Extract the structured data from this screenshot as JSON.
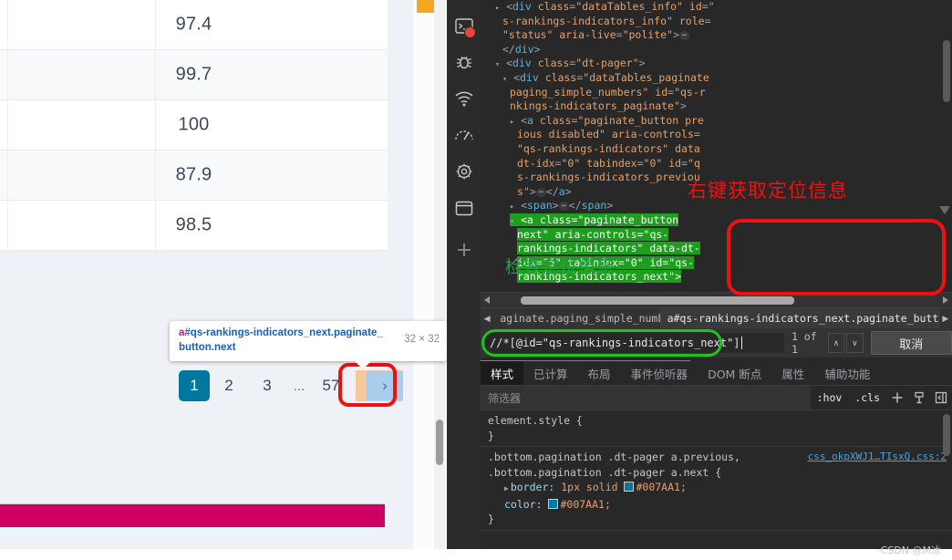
{
  "page": {
    "table": {
      "rows": [
        {
          "value": "97.4"
        },
        {
          "value": "99.7"
        },
        {
          "value": "100"
        },
        {
          "value": "87.9"
        },
        {
          "value": "98.5"
        }
      ]
    },
    "pagination": {
      "pages": [
        "1",
        "2",
        "3",
        "...",
        "57"
      ],
      "active": "1",
      "next_label": "›",
      "next_title": "next"
    },
    "tooltip": {
      "tag": "a",
      "selector": "#qs-rankings-indicators_next.paginate_button.next",
      "size": "32 × 32"
    }
  },
  "devtools": {
    "sidebar_icons": [
      {
        "name": "console-icon",
        "badge": "error"
      },
      {
        "name": "bug-icon"
      },
      {
        "name": "network-icon"
      },
      {
        "name": "performance-icon"
      },
      {
        "name": "memory-chip-icon"
      },
      {
        "name": "application-icon"
      },
      {
        "name": "add-icon"
      }
    ],
    "dom_lines": [
      {
        "indent": 2,
        "segs": [
          {
            "t": "tri",
            "v": "▸"
          },
          {
            "t": "punct",
            "v": "<"
          },
          {
            "t": "tag",
            "v": "div"
          },
          {
            "t": "sp",
            "v": " "
          },
          {
            "t": "attr",
            "v": "class"
          },
          {
            "t": "punct",
            "v": "="
          },
          {
            "t": "str",
            "v": "\"dataTables_info\""
          },
          {
            "t": "sp",
            "v": " "
          },
          {
            "t": "attr",
            "v": "id"
          },
          {
            "t": "punct",
            "v": "=\""
          }
        ]
      },
      {
        "indent": 3,
        "segs": [
          {
            "t": "str",
            "v": "s-rankings-indicators_info\""
          },
          {
            "t": "sp",
            "v": " "
          },
          {
            "t": "attr",
            "v": "role"
          },
          {
            "t": "punct",
            "v": "="
          }
        ]
      },
      {
        "indent": 3,
        "segs": [
          {
            "t": "str",
            "v": "\"status\""
          },
          {
            "t": "sp",
            "v": " "
          },
          {
            "t": "attr",
            "v": "aria-live"
          },
          {
            "t": "punct",
            "v": "="
          },
          {
            "t": "str",
            "v": "\"polite\""
          },
          {
            "t": "punct",
            "v": ">"
          },
          {
            "t": "ellip",
            "v": "⋯"
          }
        ]
      },
      {
        "indent": 3,
        "segs": [
          {
            "t": "punct",
            "v": "</"
          },
          {
            "t": "tag",
            "v": "div"
          },
          {
            "t": "punct",
            "v": ">"
          }
        ]
      },
      {
        "indent": 2,
        "segs": [
          {
            "t": "tri",
            "v": "▾"
          },
          {
            "t": "punct",
            "v": "<"
          },
          {
            "t": "tag",
            "v": "div"
          },
          {
            "t": "sp",
            "v": " "
          },
          {
            "t": "attr",
            "v": "class"
          },
          {
            "t": "punct",
            "v": "="
          },
          {
            "t": "str",
            "v": "\"dt-pager\""
          },
          {
            "t": "punct",
            "v": ">"
          }
        ]
      },
      {
        "indent": 3,
        "segs": [
          {
            "t": "tri",
            "v": "▾"
          },
          {
            "t": "punct",
            "v": "<"
          },
          {
            "t": "tag",
            "v": "div"
          },
          {
            "t": "sp",
            "v": " "
          },
          {
            "t": "attr",
            "v": "class"
          },
          {
            "t": "punct",
            "v": "="
          },
          {
            "t": "str",
            "v": "\"dataTables_paginate"
          }
        ]
      },
      {
        "indent": 4,
        "segs": [
          {
            "t": "str",
            "v": "paging_simple_numbers\""
          },
          {
            "t": "sp",
            "v": " "
          },
          {
            "t": "attr",
            "v": "id"
          },
          {
            "t": "punct",
            "v": "="
          },
          {
            "t": "str",
            "v": "\"qs-r"
          }
        ]
      },
      {
        "indent": 4,
        "segs": [
          {
            "t": "str",
            "v": "nkings-indicators_paginate\""
          },
          {
            "t": "punct",
            "v": ">"
          }
        ]
      },
      {
        "indent": 4,
        "segs": [
          {
            "t": "tri",
            "v": "▸"
          },
          {
            "t": "punct",
            "v": "<"
          },
          {
            "t": "tag",
            "v": "a"
          },
          {
            "t": "sp",
            "v": " "
          },
          {
            "t": "attr",
            "v": "class"
          },
          {
            "t": "punct",
            "v": "="
          },
          {
            "t": "str",
            "v": "\"paginate_button pre"
          }
        ]
      },
      {
        "indent": 5,
        "segs": [
          {
            "t": "str",
            "v": "ious disabled\""
          },
          {
            "t": "sp",
            "v": " "
          },
          {
            "t": "attr",
            "v": "aria-controls"
          },
          {
            "t": "punct",
            "v": "="
          }
        ]
      },
      {
        "indent": 5,
        "segs": [
          {
            "t": "str",
            "v": "\"qs-rankings-indicators\""
          },
          {
            "t": "sp",
            "v": " "
          },
          {
            "t": "attr",
            "v": "data"
          }
        ]
      },
      {
        "indent": 5,
        "segs": [
          {
            "t": "attr",
            "v": "dt-idx"
          },
          {
            "t": "punct",
            "v": "="
          },
          {
            "t": "str",
            "v": "\"0\""
          },
          {
            "t": "sp",
            "v": " "
          },
          {
            "t": "attr",
            "v": "tabindex"
          },
          {
            "t": "punct",
            "v": "="
          },
          {
            "t": "str",
            "v": "\"0\""
          },
          {
            "t": "sp",
            "v": " "
          },
          {
            "t": "attr",
            "v": "id"
          },
          {
            "t": "punct",
            "v": "="
          },
          {
            "t": "str",
            "v": "\"q"
          }
        ]
      },
      {
        "indent": 5,
        "segs": [
          {
            "t": "str",
            "v": "s-rankings-indicators_previou"
          }
        ]
      },
      {
        "indent": 5,
        "segs": [
          {
            "t": "str",
            "v": "s"
          },
          {
            "t": "punct",
            "v": "\">"
          },
          {
            "t": "ellip",
            "v": "⋯"
          },
          {
            "t": "punct",
            "v": "</"
          },
          {
            "t": "tag",
            "v": "a"
          },
          {
            "t": "punct",
            "v": ">"
          }
        ]
      },
      {
        "indent": 4,
        "segs": [
          {
            "t": "tri",
            "v": "▸"
          },
          {
            "t": "punct",
            "v": "<"
          },
          {
            "t": "tag",
            "v": "span"
          },
          {
            "t": "punct",
            "v": ">"
          },
          {
            "t": "ellip",
            "v": "⋯"
          },
          {
            "t": "punct",
            "v": "</"
          },
          {
            "t": "tag",
            "v": "span"
          },
          {
            "t": "punct",
            "v": ">"
          }
        ]
      },
      {
        "indent": 4,
        "hl": true,
        "segs": [
          {
            "t": "tri",
            "v": "▾"
          },
          {
            "t": "punct",
            "v": "<"
          },
          {
            "t": "tag",
            "v": "a"
          },
          {
            "t": "sp",
            "v": " "
          },
          {
            "t": "attr",
            "v": "class"
          },
          {
            "t": "punct",
            "v": "="
          },
          {
            "t": "str",
            "v": "\"paginate_button"
          }
        ]
      },
      {
        "indent": 5,
        "hl": true,
        "segs": [
          {
            "t": "str",
            "v": "next\""
          },
          {
            "t": "sp",
            "v": " "
          },
          {
            "t": "attr",
            "v": "aria-controls"
          },
          {
            "t": "punct",
            "v": "="
          },
          {
            "t": "str",
            "v": "\"qs-"
          }
        ]
      },
      {
        "indent": 5,
        "hl": true,
        "segs": [
          {
            "t": "str",
            "v": "rankings-indicators\""
          },
          {
            "t": "sp",
            "v": " "
          },
          {
            "t": "attr",
            "v": "data-dt-"
          }
        ]
      },
      {
        "indent": 5,
        "hl": true,
        "segs": [
          {
            "t": "attr",
            "v": "idx"
          },
          {
            "t": "punct",
            "v": "="
          },
          {
            "t": "str",
            "v": "\"5\""
          },
          {
            "t": "sp",
            "v": " "
          },
          {
            "t": "attr",
            "v": "tabindex"
          },
          {
            "t": "punct",
            "v": "="
          },
          {
            "t": "str",
            "v": "\"0\""
          },
          {
            "t": "sp",
            "v": " "
          },
          {
            "t": "attr",
            "v": "id"
          },
          {
            "t": "punct",
            "v": "="
          },
          {
            "t": "str",
            "v": "\"qs-"
          }
        ]
      },
      {
        "indent": 5,
        "hl": true,
        "segs": [
          {
            "t": "str",
            "v": "rankings-indicators_next\""
          },
          {
            "t": "punct",
            "v": ">"
          }
        ]
      }
    ],
    "annotations": {
      "red": "右键获取定位信息",
      "green": "检查定位信息"
    },
    "breadcrumbs": [
      {
        "label": "aginate.paging_simple_numbers",
        "selected": false
      },
      {
        "label": "a#qs-rankings-indicators_next.paginate_button.next",
        "selected": true
      }
    ],
    "search": {
      "value": "//*[@id=\"qs-rankings-indicators_next\"]",
      "match_count": "1 of 1",
      "prev_label": "∧",
      "next_label": "∨",
      "cancel_label": "取消"
    },
    "tabs": [
      {
        "label": "样式",
        "active": true
      },
      {
        "label": "已计算",
        "active": false
      },
      {
        "label": "布局",
        "active": false
      },
      {
        "label": "事件侦听器",
        "active": false
      },
      {
        "label": "DOM 断点",
        "active": false
      },
      {
        "label": "属性",
        "active": false
      },
      {
        "label": "辅助功能",
        "active": false
      }
    ],
    "filter": {
      "placeholder": "筛选器",
      "hov_label": ":hov",
      "cls_label": ".cls"
    },
    "styles": {
      "element_style_open": "element.style {",
      "element_style_close": "}",
      "rule_selector_line1": ".bottom.pagination .dt-pager a.previous,",
      "rule_selector_line2": ".bottom.pagination .dt-pager a.next {",
      "source": "css_okpXWJ1…TIsxQ.css:2",
      "prop_border_name": "border:",
      "prop_border_value": "1px solid",
      "prop_border_color": "#007AA1;",
      "prop_color_name": "color:",
      "prop_color_value": "#007AA1;",
      "rule_close": "}",
      "accent_color": "#007AA1"
    }
  },
  "watermark": "CSDN @M冰"
}
